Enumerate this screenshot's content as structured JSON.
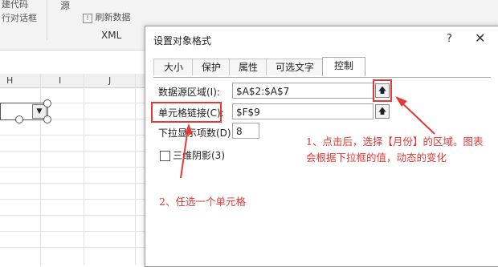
{
  "ribbon": {
    "top_left_1": "建代码",
    "top_left_2": "行对话框",
    "source_label": "源",
    "refresh_label": "刷新数据",
    "xml_label": "XML"
  },
  "sheet": {
    "columns": [
      "H",
      "I",
      "J"
    ]
  },
  "dialog": {
    "title": "设置对象格式",
    "help": "?",
    "close": "✕",
    "tabs": [
      "大小",
      "保护",
      "属性",
      "可选文字",
      "控制"
    ],
    "active_tab": "控制",
    "input_range_label": "数据源区域(I):",
    "input_range_value": "$A$2:$A$7",
    "cell_link_label": "单元格链接(C):",
    "cell_link_value": "$F$9",
    "drop_lines_label": "下拉显示项数(D):",
    "drop_lines_value": "8",
    "shading_label": "三维阴影(3)",
    "picker_icon": "upload-arrow-icon"
  },
  "annotations": {
    "note1": "1、点击后，选择【月份】的区域。图表会根据下拉框的值，动态的变化",
    "note2": "2、任选一个单元格"
  }
}
